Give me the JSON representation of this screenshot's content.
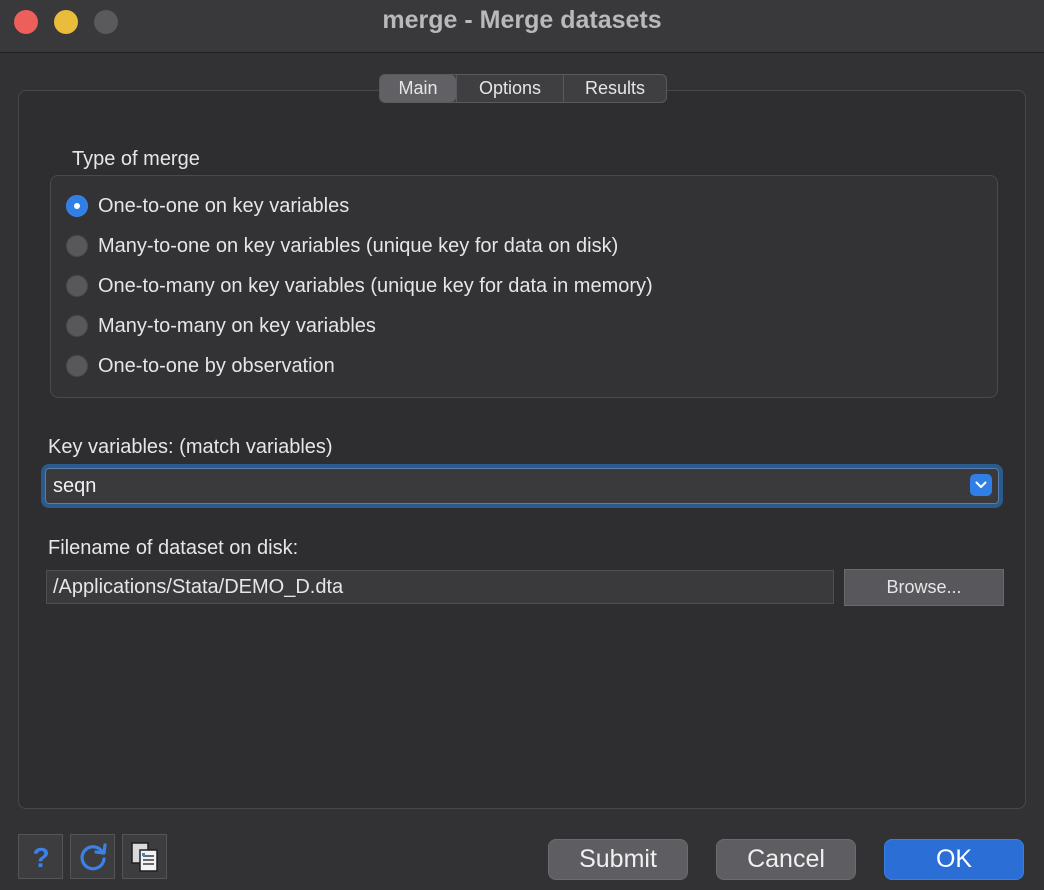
{
  "window": {
    "title": "merge - Merge datasets"
  },
  "tabs": [
    {
      "label": "Main",
      "active": true
    },
    {
      "label": "Options",
      "active": false
    },
    {
      "label": "Results",
      "active": false
    }
  ],
  "merge_type": {
    "heading": "Type of merge",
    "options": [
      {
        "label": "One-to-one on key variables",
        "selected": true
      },
      {
        "label": "Many-to-one on key variables (unique key for data on disk)",
        "selected": false
      },
      {
        "label": "One-to-many on key variables (unique key for data in memory)",
        "selected": false
      },
      {
        "label": "Many-to-many on key variables",
        "selected": false
      },
      {
        "label": "One-to-one by observation",
        "selected": false
      }
    ]
  },
  "key_variables": {
    "label": "Key variables: (match variables)",
    "value": "seqn"
  },
  "filename": {
    "label": "Filename of dataset on disk:",
    "value": "/Applications/Stata/DEMO_D.dta",
    "browse_label": "Browse..."
  },
  "footer": {
    "help_icon": "help-icon",
    "reset_icon": "reset-icon",
    "copy_icon": "copy-command-icon",
    "submit_label": "Submit",
    "cancel_label": "Cancel",
    "ok_label": "OK"
  },
  "colors": {
    "accent": "#2f7fe6",
    "focus_ring": "#2a5a8e",
    "window_bg": "#323235"
  }
}
